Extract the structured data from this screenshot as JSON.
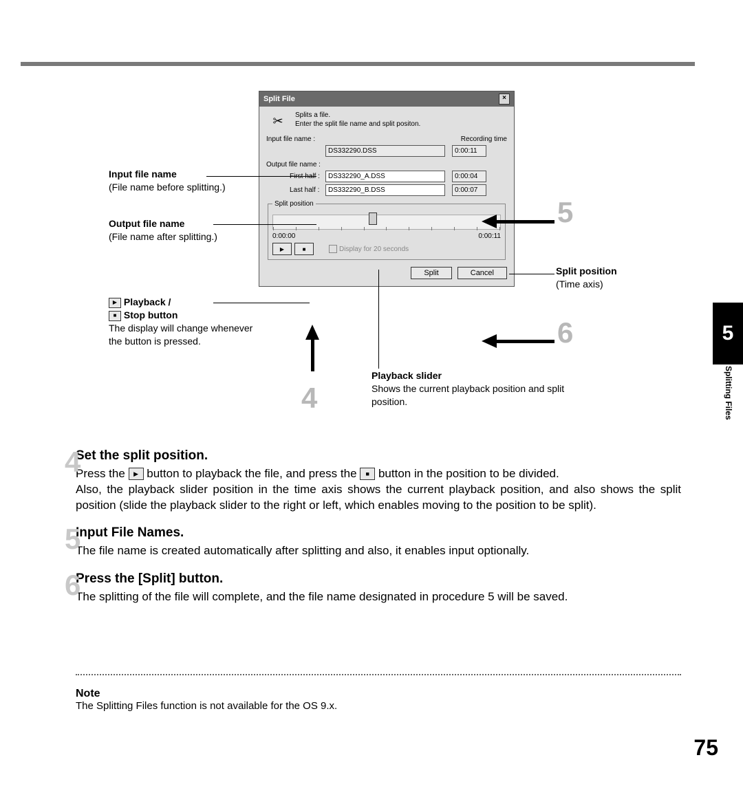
{
  "sideTab": "5",
  "sideText": "Splitting Files",
  "pageNum": "75",
  "dialog": {
    "title": "Split File",
    "hdr1": "Splits a file.",
    "hdr2": "Enter the split file name and split positon.",
    "lblInputFile": "Input file name :",
    "lblRecTime": "Recording time",
    "inputFile": "DS332290.DSS",
    "inputTime": "0:00:11",
    "lblOutputFile": "Output file name :",
    "lblFirst": "First half :",
    "firstFile": "DS332290_A.DSS",
    "firstTime": "0:00:04",
    "lblLast": "Last half :",
    "lastFile": "DS332290_B.DSS",
    "lastTime": "0:00:07",
    "lblSplitPos": "Split position",
    "timeStart": "0:00:00",
    "timeEnd": "0:00:11",
    "chkLbl": "Display for 20 seconds",
    "btnSplit": "Split",
    "btnCancel": "Cancel"
  },
  "callouts": {
    "c1b": "Input file name",
    "c1": "(File name before splitting.)",
    "c2b": "Output file name",
    "c2": "(File name after splitting.)",
    "c3b1": "Playback /",
    "c3b2": "Stop button",
    "c3": "The display will change whenever the button is pressed.",
    "c4b": "Playback slider",
    "c4": "Shows the current playback position and split position.",
    "c5b": "Split position",
    "c5": "(Time axis)"
  },
  "nums": {
    "n4": "4",
    "n5": "5",
    "n6": "6"
  },
  "steps": {
    "s4h": "Set the split position.",
    "s4a": "Press the ",
    "s4b": " button to playback the file, and press the ",
    "s4c": " button in the position to be divided.",
    "s4d": "Also, the playback slider position in the time axis shows the current playback position, and also shows the split position (slide the playback slider to the right or left, which enables moving to the position to be split).",
    "s5h": "Input File Names.",
    "s5": "The file name is created automatically after splitting and also, it enables input optionally.",
    "s6h": "Press the [Split] button.",
    "s6": "The splitting of the file will complete, and the file name designated in procedure 5 will be saved."
  },
  "note": {
    "h": "Note",
    "t": "The Splitting Files function is not available for the OS 9.x."
  }
}
